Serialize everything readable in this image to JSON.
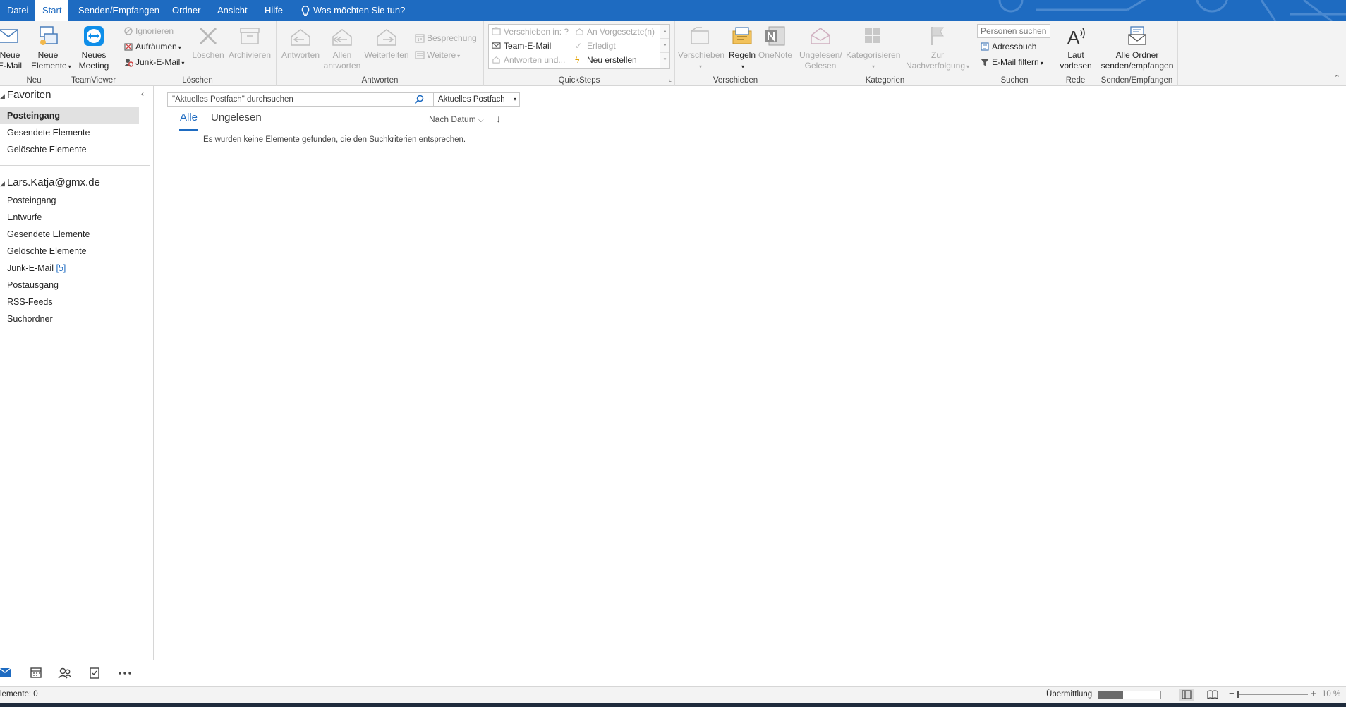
{
  "menubar": {
    "tabs": [
      "Datei",
      "Start",
      "Senden/Empfangen",
      "Ordner",
      "Ansicht",
      "Hilfe"
    ],
    "active_tab": "Start",
    "tell_me": "Was möchten Sie tun?"
  },
  "ribbon": {
    "neu": {
      "label": "Neu",
      "new_email": "Neue\nE-Mail",
      "new_items": "Neue\nElemente"
    },
    "teamviewer": {
      "label": "TeamViewer",
      "new_meeting": "Neues\nMeeting"
    },
    "loeschen": {
      "label": "Löschen",
      "ignore": "Ignorieren",
      "cleanup": "Aufräumen",
      "junk": "Junk-E-Mail",
      "delete": "Löschen",
      "archive": "Archivieren"
    },
    "antworten": {
      "label": "Antworten",
      "reply": "Antworten",
      "reply_all": "Allen\nantworten",
      "forward": "Weiterleiten",
      "meeting": "Besprechung",
      "more": "Weitere"
    },
    "quicksteps": {
      "label": "QuickSteps",
      "items": [
        "Verschieben in: ?",
        "Team-E-Mail",
        "Antworten und...",
        "An Vorgesetzte(n)",
        "Erledigt",
        "Neu erstellen"
      ]
    },
    "verschieben": {
      "label": "Verschieben",
      "move": "Verschieben",
      "rules": "Regeln",
      "onenote": "OneNote"
    },
    "kategorien": {
      "label": "Kategorien",
      "unread_read": "Ungelesen/\nGelesen",
      "categorize": "Kategorisieren",
      "followup": "Zur\nNachverfolgung"
    },
    "suchen": {
      "label": "Suchen",
      "people_placeholder": "Personen suchen",
      "address_book": "Adressbuch",
      "filter_email": "E-Mail filtern"
    },
    "rede": {
      "label": "Rede",
      "read_aloud": "Laut\nvorlesen"
    },
    "sendrecv": {
      "label": "Senden/Empfangen",
      "all_folders": "Alle Ordner\nsenden/empfangen"
    }
  },
  "nav": {
    "favorites_title": "Favoriten",
    "favorites": [
      "Posteingang",
      "Gesendete Elemente",
      "Gelöschte Elemente"
    ],
    "account_title": "Lars.Katja@gmx.de",
    "folders": [
      {
        "name": "Posteingang",
        "count": ""
      },
      {
        "name": "Entwürfe",
        "count": ""
      },
      {
        "name": "Gesendete Elemente",
        "count": ""
      },
      {
        "name": "Gelöschte Elemente",
        "count": ""
      },
      {
        "name": "Junk-E-Mail",
        "count": "[5]"
      },
      {
        "name": "Postausgang",
        "count": ""
      },
      {
        "name": "RSS-Feeds",
        "count": ""
      },
      {
        "name": "Suchordner",
        "count": ""
      }
    ]
  },
  "list": {
    "search_placeholder": "\"Aktuelles Postfach\" durchsuchen",
    "scope": "Aktuelles Postfach",
    "tab_all": "Alle",
    "tab_unread": "Ungelesen",
    "sort": "Nach Datum",
    "empty_message": "Es wurden keine Elemente gefunden, die den Suchkriterien entsprechen."
  },
  "status": {
    "items": "lemente: 0",
    "upload": "Übermittlung",
    "progress": 0.4,
    "zoom": "10 %"
  },
  "colors": {
    "accent": "#1e6bc1",
    "ribbon_bg": "#f3f3f3"
  }
}
